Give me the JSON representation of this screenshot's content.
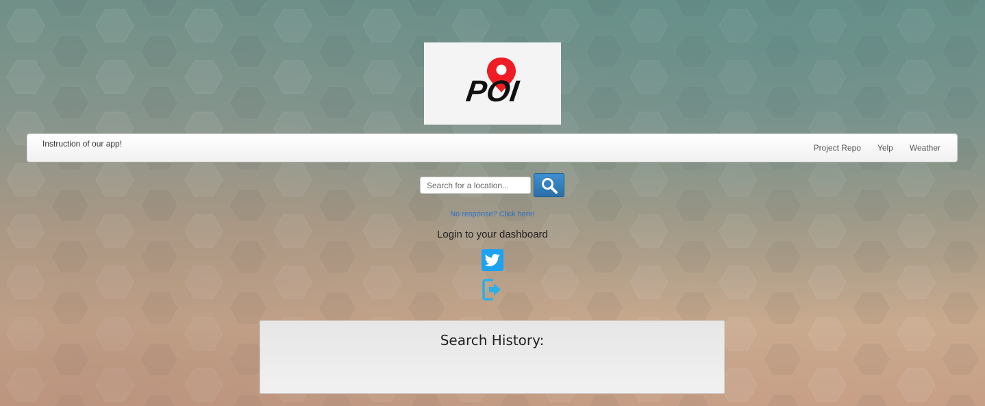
{
  "logo": {
    "text": "POI",
    "pin_color": "#ef1c24"
  },
  "navbar": {
    "brand": "Instruction of our app!",
    "links": [
      "Project Repo",
      "Yelp",
      "Weather"
    ]
  },
  "search": {
    "placeholder": "Search for a location...",
    "value": "",
    "button_icon": "search-icon"
  },
  "no_response_link": "No response? Click here!",
  "login": {
    "text": "Login to your dashboard",
    "twitter_icon": "twitter-icon",
    "logout_icon": "sign-out-icon"
  },
  "search_history": {
    "title": "Search History:",
    "items": []
  },
  "colors": {
    "accent": "#2a6fa8",
    "link": "#2a6fc6",
    "twitter": "#1da1f2",
    "logout_icon": "#27b1e6"
  }
}
